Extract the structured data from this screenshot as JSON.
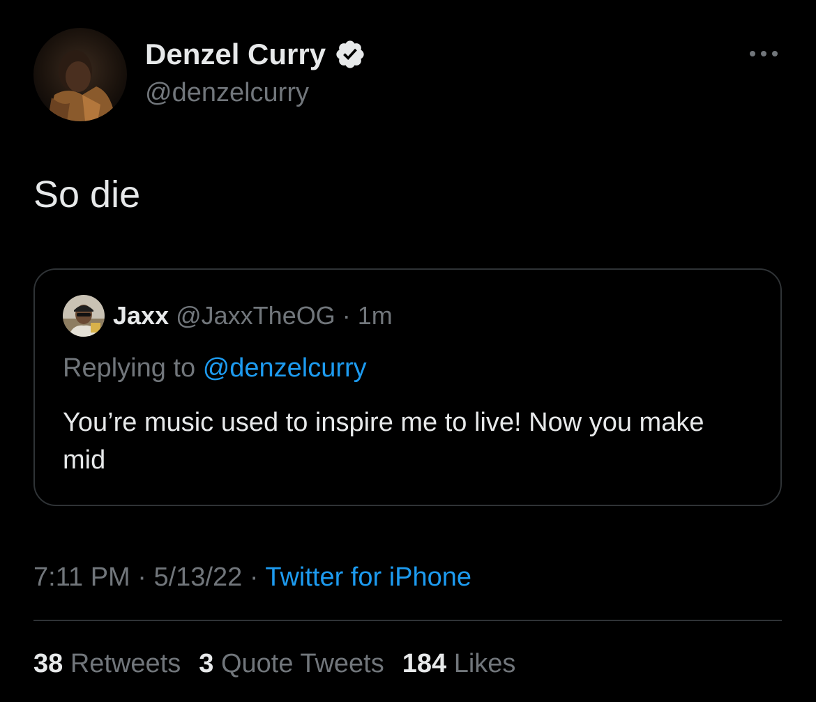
{
  "tweet": {
    "author": {
      "name": "Denzel Curry",
      "handle": "@denzelcurry",
      "verified_icon": "verified-badge-icon",
      "avatar": "profile-photo"
    },
    "more_icon": "more-horizontal-icon",
    "text": "So die",
    "quote": {
      "name": "Jaxx",
      "handle": "@JaxxTheOG",
      "separator": "·",
      "time": "1m",
      "replying_prefix": "Replying to",
      "replying_to": "@denzelcurry",
      "text": "You’re music used to inspire me to live! Now you make mid"
    },
    "meta": {
      "time": "7:11 PM",
      "date": "5/13/22",
      "source": "Twitter for iPhone",
      "separator": "·"
    },
    "stats": {
      "retweets_count": "38",
      "retweets_label": "Retweets",
      "quotes_count": "3",
      "quotes_label": "Quote Tweets",
      "likes_count": "184",
      "likes_label": "Likes"
    }
  },
  "colors": {
    "background": "#000000",
    "text": "#e7e9ea",
    "secondary_text": "#71767b",
    "accent": "#1d9bf0",
    "border": "#2f3336"
  }
}
